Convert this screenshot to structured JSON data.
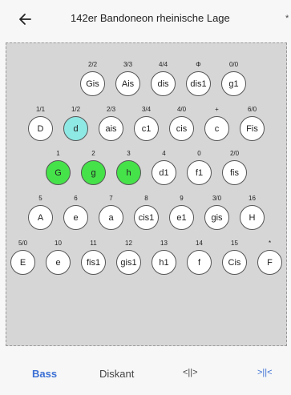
{
  "header": {
    "title": "142er Bandoneon rheinische Lage",
    "star": "*"
  },
  "rows": [
    {
      "keys": [
        {
          "n": "Gis",
          "l": "2/2"
        },
        {
          "n": "Ais",
          "l": "3/3"
        },
        {
          "n": "dis",
          "l": "4/4"
        },
        {
          "n": "dis1",
          "l": "Φ"
        },
        {
          "n": "g1",
          "l": "0/0"
        }
      ]
    },
    {
      "keys": [
        {
          "n": "D",
          "l": "1/1"
        },
        {
          "n": "d",
          "l": "1/2",
          "c": "cyan"
        },
        {
          "n": "ais",
          "l": "2/3"
        },
        {
          "n": "c1",
          "l": "3/4"
        },
        {
          "n": "cis",
          "l": "4/0"
        },
        {
          "n": "c",
          "l": "+"
        },
        {
          "n": "Fis",
          "l": "6/0"
        }
      ]
    },
    {
      "keys": [
        {
          "n": "G",
          "l": "1",
          "c": "green"
        },
        {
          "n": "g",
          "l": "2",
          "c": "green"
        },
        {
          "n": "h",
          "l": "3",
          "c": "green"
        },
        {
          "n": "d1",
          "l": "4"
        },
        {
          "n": "f1",
          "l": "0"
        },
        {
          "n": "fis",
          "l": "2/0"
        }
      ]
    },
    {
      "keys": [
        {
          "n": "A",
          "l": "5"
        },
        {
          "n": "e",
          "l": "6"
        },
        {
          "n": "a",
          "l": "7"
        },
        {
          "n": "cis1",
          "l": "8"
        },
        {
          "n": "e1",
          "l": "9"
        },
        {
          "n": "gis",
          "l": "3/0"
        },
        {
          "n": "H",
          "l": "16"
        }
      ]
    },
    {
      "keys": [
        {
          "n": "E",
          "l": "5/0"
        },
        {
          "n": "e",
          "l": "10"
        },
        {
          "n": "fis1",
          "l": "11"
        },
        {
          "n": "gis1",
          "l": "12"
        },
        {
          "n": "h1",
          "l": "13"
        },
        {
          "n": "f",
          "l": "14"
        },
        {
          "n": "Cis",
          "l": "15"
        },
        {
          "n": "F",
          "l": "*"
        }
      ]
    }
  ],
  "colors": {
    "green": "#46e24a",
    "cyan": "#8ee8e4",
    "accent": "#3b6fd4"
  },
  "tabs": {
    "bass": "Bass",
    "diskant": "Diskant",
    "t3": "<||>",
    "t4": ">||<"
  }
}
